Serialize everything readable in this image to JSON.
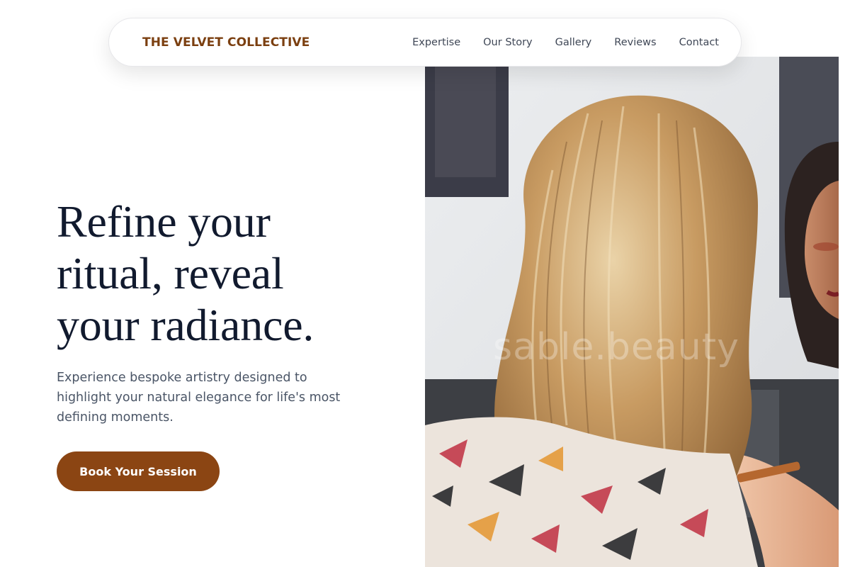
{
  "navbar": {
    "brand": "THE VELVET COLLECTIVE",
    "links": [
      "Expertise",
      "Our Story",
      "Gallery",
      "Reviews",
      "Contact"
    ]
  },
  "hero": {
    "headline_lines": [
      "Refine your",
      "ritual, reveal",
      "your radiance."
    ],
    "subhead": "Experience bespoke artistry designed to highlight your natural elegance for life's most defining moments.",
    "cta_label": "Book Your Session",
    "image_watermark": "sable.beauty"
  },
  "colors": {
    "brand": "#7b3f10",
    "cta_background": "#8b4513",
    "headline": "#111a2e",
    "body_text": "#4a5566"
  }
}
